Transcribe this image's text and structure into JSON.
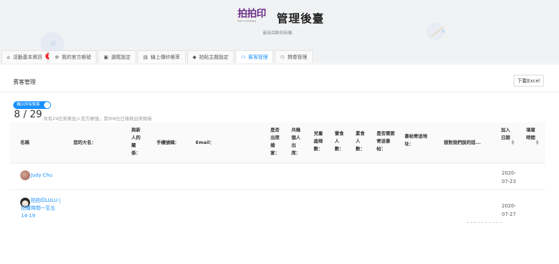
{
  "brand": {
    "logo_text": "拍拍印",
    "logo_tagline": "Click on Anything",
    "title": "管理後臺",
    "subtitle": "最強活動拍貼機"
  },
  "tabs": [
    {
      "label": "活動基本資訊",
      "icon": "home-icon",
      "badge": "1"
    },
    {
      "label": "我的官方帳號",
      "icon": "globe-icon"
    },
    {
      "label": "選框設定",
      "icon": "frame-icon"
    },
    {
      "label": "線上傳紗帳率",
      "icon": "document-icon"
    },
    {
      "label": "拍貼主題設定",
      "icon": "apple-icon"
    },
    {
      "label": "賓客管理",
      "icon": "users-icon",
      "active": true
    },
    {
      "label": "問卷管理",
      "icon": "users-icon"
    }
  ],
  "panel": {
    "title": "賓客管理",
    "export_label": "下載Excel"
  },
  "filter": {
    "switch_label": "顯示所有賓客",
    "count": "8 / 29",
    "note": "共有29位來賓加入官方帳號，其中8位已填寫出席問卷"
  },
  "columns": {
    "name": "名稱",
    "your_name": "您的大名：",
    "relation": "與新人的關係：",
    "phone": "手機號碼：",
    "email": "Email：",
    "attend": "是否出席婚宴：",
    "count_attend": "共幾個人出席：",
    "child_seat": "兒童座椅數：",
    "meat": "葷食人數：",
    "veg": "素食人數：",
    "invite": "是否需要寄送喜帖：",
    "address": "喜帖寄送地址：",
    "message": "想對我們說的話...",
    "join_date": "加入日期",
    "fill_time": "填寫時間"
  },
  "rows": [
    {
      "name": "Judy Chu",
      "join_date": "2020-07-23",
      "avatar": "avatar"
    },
    {
      "name": "拍拍印LULU | 回覆時間一至五 14-19",
      "join_date": "2020-07-27",
      "avatar": "avatar"
    }
  ],
  "colors": {
    "accent": "#1890ff",
    "badge": "#f5222d",
    "brand_purple": "#6b2d86"
  }
}
